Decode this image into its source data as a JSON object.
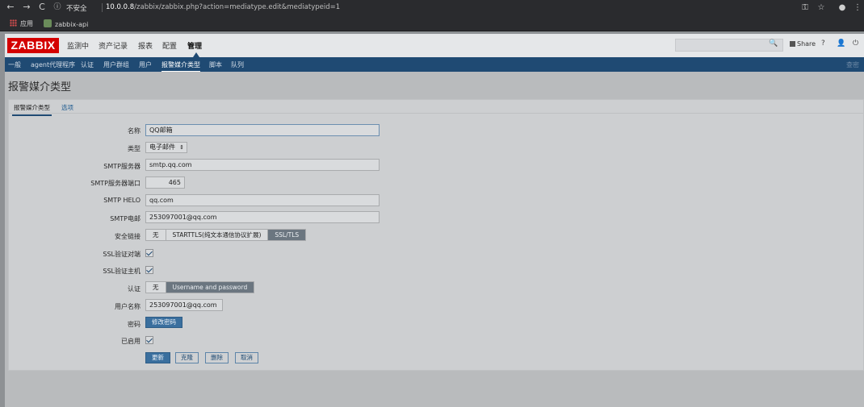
{
  "browser": {
    "back": "←",
    "forward": "→",
    "reload": "C",
    "security_icon": "ⓘ",
    "security_label": "不安全",
    "url_host": "10.0.0.8",
    "url_path": "/zabbix/zabbix.php?action=mediatype.edit&mediatypeid=1",
    "key_icon": "⚿",
    "star_icon": "☆",
    "profile_icon": "●",
    "menu_icon": "⋮",
    "bookmarks": [
      {
        "label": "应用"
      },
      {
        "label": "zabbix-api"
      }
    ]
  },
  "header": {
    "logo": "ZABBIX",
    "menu": [
      "监测中",
      "资产记录",
      "报表",
      "配置",
      "管理"
    ],
    "active_menu": "管理",
    "search_icon": "🔍",
    "share_label": "Share",
    "help_icon": "?",
    "user_icon": "👤",
    "power_icon": "⏻"
  },
  "submenu": {
    "items": [
      "一般",
      "agent代理程序",
      "认证",
      "用户群组",
      "用户",
      "报警媒介类型",
      "脚本",
      "队列"
    ],
    "active": "报警媒介类型",
    "right_text": "查密"
  },
  "page": {
    "title": "报警媒介类型",
    "tabs": [
      "报警媒介类型",
      "选项"
    ]
  },
  "form": {
    "name": {
      "label": "名称",
      "value": "QQ邮箱"
    },
    "type": {
      "label": "类型",
      "value": "电子邮件",
      "arrow": "⇕"
    },
    "smtp_server": {
      "label": "SMTP服务器",
      "value": "smtp.qq.com"
    },
    "smtp_port": {
      "label": "SMTP服务器端口",
      "value": "465"
    },
    "smtp_helo": {
      "label": "SMTP HELO",
      "value": "qq.com"
    },
    "smtp_email": {
      "label": "SMTP电邮",
      "value": "253097001@qq.com"
    },
    "security": {
      "label": "安全链接",
      "options": [
        "无",
        "STARTTLS(纯文本通信协议扩展)",
        "SSL/TLS"
      ],
      "selected": "SSL/TLS"
    },
    "ssl_verify_peer": {
      "label": "SSL验证对端",
      "checked": true
    },
    "ssl_verify_host": {
      "label": "SSL验证主机",
      "checked": true
    },
    "auth": {
      "label": "认证",
      "options": [
        "无",
        "Username and password"
      ],
      "selected": "Username and password"
    },
    "username": {
      "label": "用户名称",
      "value": "253097001@qq.com"
    },
    "password": {
      "label": "密码",
      "button": "修改密码"
    },
    "enabled": {
      "label": "已启用",
      "checked": true
    },
    "buttons": {
      "update": "更新",
      "clone": "克隆",
      "delete": "删除",
      "cancel": "取消"
    }
  }
}
